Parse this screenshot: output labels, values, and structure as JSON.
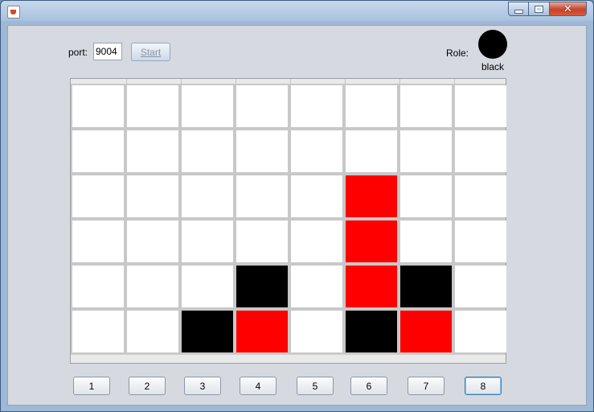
{
  "window": {
    "min_label": "",
    "max_label": "",
    "close_label": "✕"
  },
  "controls": {
    "port_label": "port:",
    "port_value": "9004",
    "start_label": "Start",
    "role_label": "Role:",
    "role_value": "black"
  },
  "colors": {
    "black": "#000000",
    "red": "#ff0000",
    "empty": "#ffffff"
  },
  "board": {
    "columns": 8,
    "rows": 6,
    "cells": [
      [
        "empty",
        "empty",
        "empty",
        "empty",
        "empty",
        "empty",
        "empty",
        "empty"
      ],
      [
        "empty",
        "empty",
        "empty",
        "empty",
        "empty",
        "empty",
        "empty",
        "empty"
      ],
      [
        "empty",
        "empty",
        "empty",
        "empty",
        "empty",
        "red",
        "empty",
        "empty"
      ],
      [
        "empty",
        "empty",
        "empty",
        "empty",
        "empty",
        "red",
        "empty",
        "empty"
      ],
      [
        "empty",
        "empty",
        "empty",
        "black",
        "empty",
        "red",
        "black",
        "empty"
      ],
      [
        "empty",
        "empty",
        "black",
        "red",
        "empty",
        "black",
        "red",
        "empty"
      ]
    ]
  },
  "column_buttons": [
    "1",
    "2",
    "3",
    "4",
    "5",
    "6",
    "7",
    "8"
  ],
  "focused_column_button": "8"
}
